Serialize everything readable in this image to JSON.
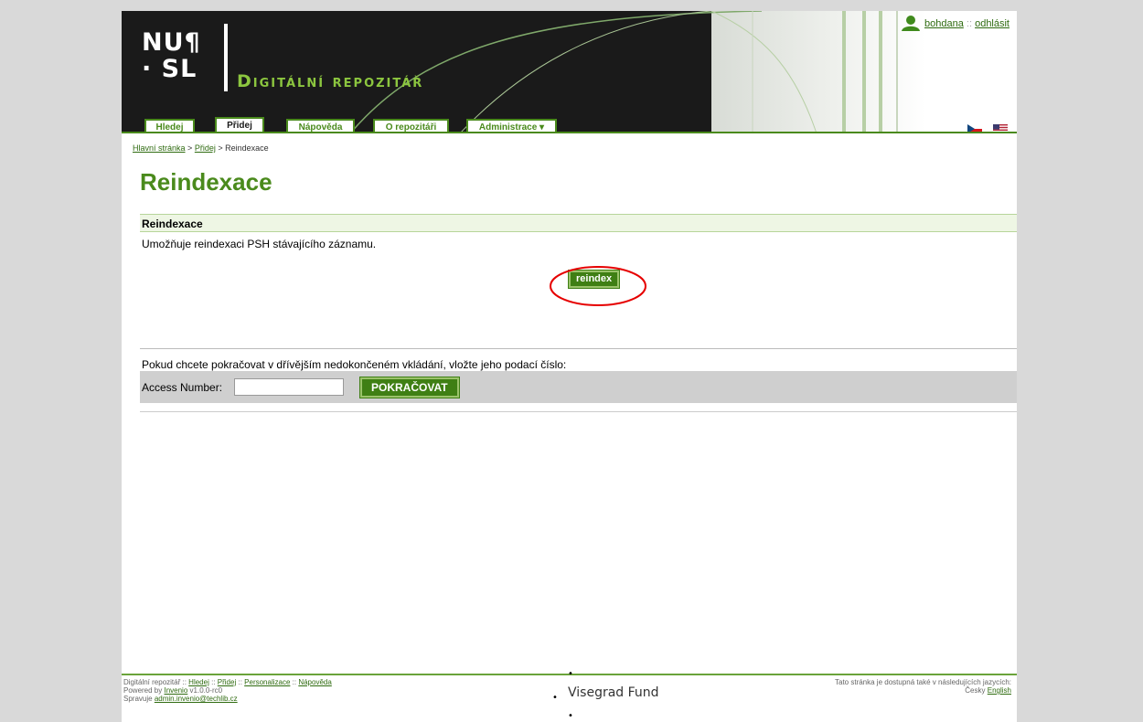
{
  "header": {
    "logo_line1": "NU¶",
    "logo_line2": "· SL",
    "site_title": "Digitální repozitář",
    "user_name": "bohdana",
    "user_sep": "::",
    "logout": "odhlásit",
    "tabs": [
      {
        "label": "Hledej"
      },
      {
        "label": "Přidej"
      },
      {
        "label": "Nápověda"
      },
      {
        "label": "O repozitáři"
      },
      {
        "label": "Administrace ▾"
      }
    ],
    "active_tab": "Přidej"
  },
  "breadcrumb": {
    "home": "Hlavní stránka",
    "sep": ">",
    "add": "Přidej",
    "current": "Reindexace"
  },
  "main": {
    "title": "Reindexace",
    "section_title": "Reindexace",
    "description": "Umožňuje reindexaci PSH stávajícího záznamu.",
    "reindex_button": "reindex",
    "continue_text": "Pokud chcete pokračovat v dřívějším nedokončeném vkládání, vložte jeho podací číslo:",
    "access_label": "Access Number:",
    "access_value": "",
    "continue_button": "POKRAČOVAT"
  },
  "footer": {
    "left": {
      "site": "Digitální repozitář",
      "sep": "::",
      "links": [
        "Hledej",
        "Přidej",
        "Personalizace",
        "Nápověda"
      ],
      "powered_by": "Powered by",
      "invenio": "Invenio",
      "version": "v1.0.0-rc0",
      "maintained_by": "Spravuje",
      "email": "admin.invenio@techlib.cz"
    },
    "center": "Visegrad Fund",
    "right": {
      "note": "Tato stránka je dostupná také v následujících jazycích:",
      "lang_cs": "Česky",
      "lang_en": "English"
    }
  },
  "colors": {
    "accent_green": "#4a8a1c",
    "button_green": "#3f7f14",
    "highlight_red": "#e60000",
    "header_dark": "#1a1a1a"
  }
}
